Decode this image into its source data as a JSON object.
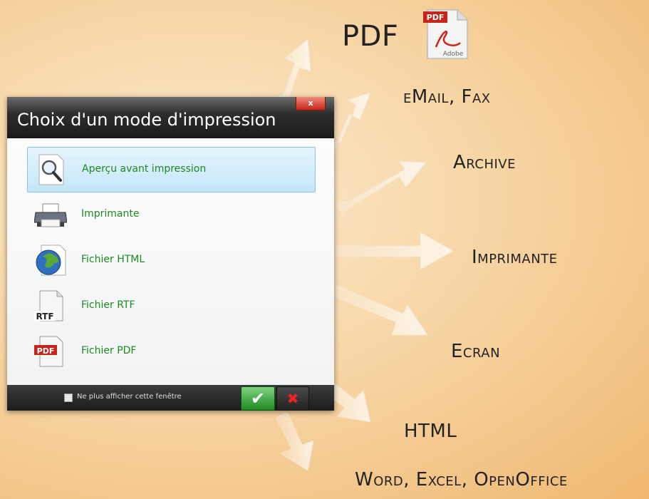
{
  "dialog": {
    "title": "Choix d'un mode d'impression",
    "close_label": "x",
    "options": [
      {
        "label": "Aperçu avant impression",
        "icon": "magnifier-icon",
        "selected": true
      },
      {
        "label": "Imprimante",
        "icon": "printer-icon",
        "selected": false
      },
      {
        "label": "Fichier HTML",
        "icon": "globe-icon",
        "selected": false
      },
      {
        "label": "Fichier RTF",
        "icon": "rtf-file-icon",
        "selected": false
      },
      {
        "label": "Fichier PDF",
        "icon": "pdf-file-icon",
        "selected": false
      }
    ],
    "dont_show_label": "Ne plus afficher cette fenêtre",
    "ok_label": "✔",
    "cancel_label": "✖"
  },
  "destinations": {
    "pdf": "PDF",
    "pdf_icon_text_top": "PDF",
    "pdf_icon_text_bottom": "Adobe",
    "email_fax": "eMail, Fax",
    "archive": "Archive",
    "imprimante": "Imprimante",
    "ecran": "Ecran",
    "html": "HTML",
    "office": "Word, Excel, OpenOffice"
  },
  "colors": {
    "accent_green": "#1e8a1e",
    "selection_blue": "#c4e6f8",
    "background_orange": "#f7d6a6"
  }
}
